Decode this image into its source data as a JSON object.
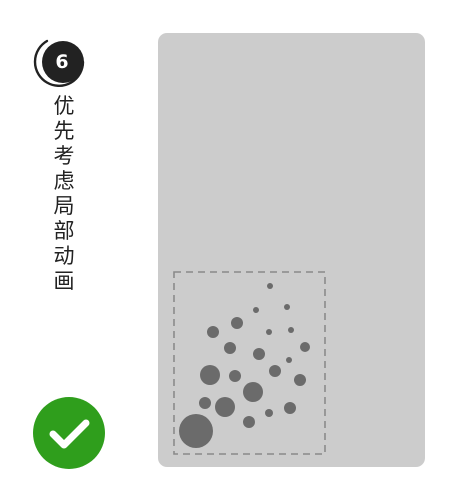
{
  "step": {
    "number": "6",
    "badge_color": "#222222"
  },
  "title": {
    "characters": [
      "优",
      "先",
      "考",
      "虑",
      "局",
      "部",
      "动",
      "画"
    ]
  },
  "check": {
    "icon": "checkmark-icon",
    "color": "#2f9e1c"
  },
  "card": {
    "background_color": "#cccccc",
    "dot_color": "#6b6b6b",
    "region_border_color": "#8a8a8a"
  }
}
